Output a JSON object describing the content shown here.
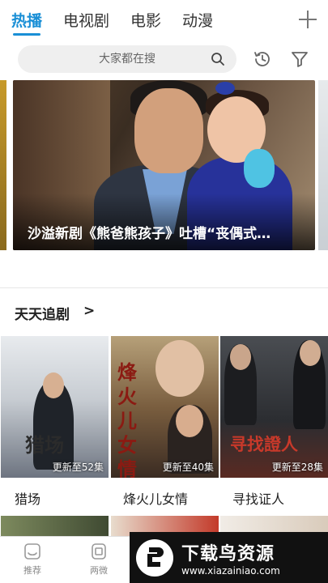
{
  "tabs": [
    {
      "label": "热播",
      "active": true
    },
    {
      "label": "电视剧",
      "active": false
    },
    {
      "label": "电影",
      "active": false
    },
    {
      "label": "动漫",
      "active": false
    }
  ],
  "search": {
    "placeholder": "大家都在搜"
  },
  "banner": {
    "caption": "沙溢新剧《熊爸熊孩子》吐槽“丧偶式…"
  },
  "section": {
    "title": "天天追剧",
    "arrow": ">"
  },
  "shows": [
    {
      "title": "猎场",
      "badge": "更新至52集",
      "poster_text": "猎场"
    },
    {
      "title": "烽火儿女情",
      "badge": "更新至40集",
      "poster_text": "烽火儿女情"
    },
    {
      "title": "寻找证人",
      "badge": "更新至28集",
      "poster_text": "寻找證人"
    }
  ],
  "bottom_nav": [
    {
      "label": "推荐",
      "icon": "recommend-icon"
    },
    {
      "label": "两微",
      "icon": "weibo-icon"
    }
  ],
  "watermark": {
    "title": "下载鸟资源",
    "url": "www.xiazainiao.com"
  },
  "colors": {
    "accent": "#1a8fd6"
  }
}
